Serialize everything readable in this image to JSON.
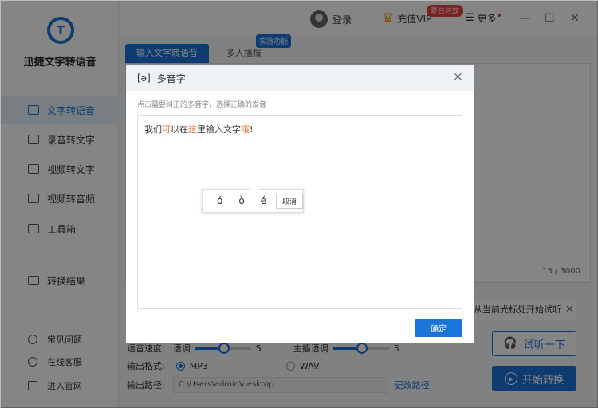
{
  "app": {
    "logo_letter": "T",
    "title": "迅捷文字转语音"
  },
  "sidebar": {
    "items": [
      {
        "label": "文字转语音",
        "active": true
      },
      {
        "label": "录音转文字"
      },
      {
        "label": "视频转文字"
      },
      {
        "label": "视频转音频"
      },
      {
        "label": "工具箱"
      },
      {
        "label": "转换结果"
      }
    ],
    "footer": [
      {
        "label": "常见问题"
      },
      {
        "label": "在线客服"
      },
      {
        "label": "进入官网"
      }
    ]
  },
  "topbar": {
    "login": "登录",
    "vip": "充值VIP",
    "vip_badge": "夏日狂欢",
    "more": "更多",
    "minimize": "—",
    "maximize": "☐",
    "close": "✕"
  },
  "tabs": [
    {
      "label": "输入文字转语音",
      "active": true
    },
    {
      "label": "多人播报"
    }
  ],
  "tab_badge": "实验功能",
  "editor": {
    "counter": "13 / 3000"
  },
  "tip_strip": {
    "text": "从当前光标处开始试听",
    "close": "✕"
  },
  "settings": {
    "speed_label": "语音速度:",
    "tone_label": "语调",
    "tone_value": "5",
    "speaker_label": "主播语调",
    "speaker_value": "5",
    "format_label": "输出格式:",
    "formats": [
      "MP3",
      "WAV"
    ],
    "selected_format": "MP3",
    "path_label": "输出路径:",
    "path_value": "C:\\Users\\admin\\desktop",
    "change_path": "更改路径"
  },
  "buttons": {
    "listen": "试听一下",
    "convert": "开始转换"
  },
  "modal": {
    "phonetic_icon": "[ə]",
    "title": "多音字",
    "close": "✕",
    "tip": "点击需要纠正的多音字，选择正确的发音",
    "sentence": [
      {
        "t": "我们",
        "poly": false
      },
      {
        "t": "可",
        "poly": true
      },
      {
        "t": "以在",
        "poly": false
      },
      {
        "t": "这",
        "poly": true
      },
      {
        "t": "里输入文字",
        "poly": false
      },
      {
        "t": "哦",
        "poly": true
      },
      {
        "t": "!",
        "poly": false
      }
    ],
    "pinyin_options": [
      "ó",
      "ò",
      "é"
    ],
    "cancel": "取消",
    "confirm": "确定"
  },
  "colors": {
    "accent": "#1b74d8",
    "polyphone": "#e8743b",
    "badge": "#e8413a"
  }
}
